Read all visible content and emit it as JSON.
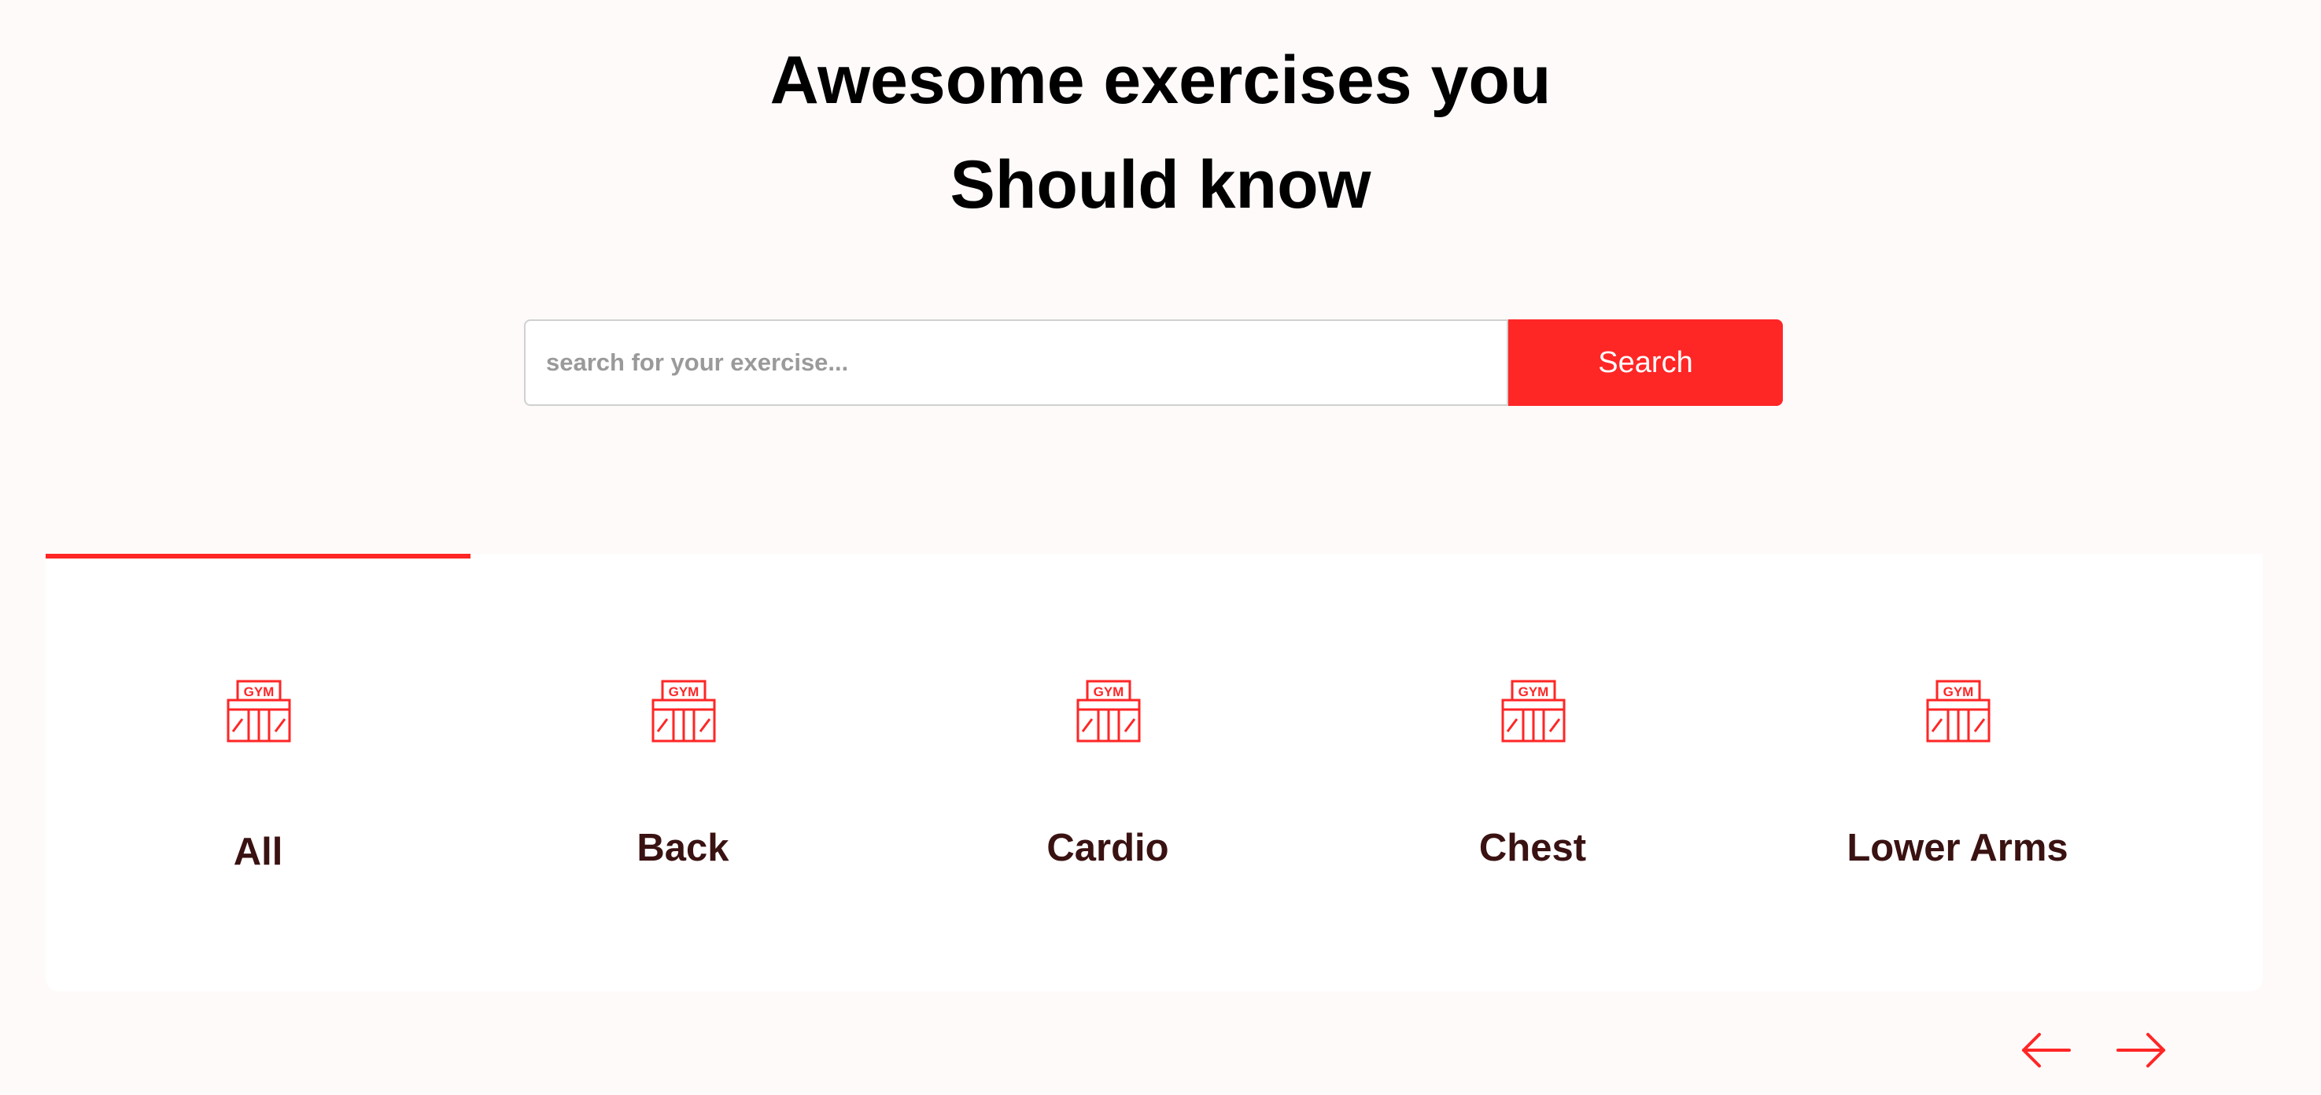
{
  "heading": {
    "line1": "Awesome exercises you",
    "line2": "Should know"
  },
  "search": {
    "placeholder": "search for your exercise...",
    "value": "",
    "button_label": "Search"
  },
  "categories": [
    {
      "label": "All",
      "icon": "gym-icon",
      "active": true
    },
    {
      "label": "Back",
      "icon": "gym-icon",
      "active": false
    },
    {
      "label": "Cardio",
      "icon": "gym-icon",
      "active": false
    },
    {
      "label": "Chest",
      "icon": "gym-icon",
      "active": false
    },
    {
      "label": "Lower Arms",
      "icon": "gym-icon",
      "active": false
    }
  ],
  "navigation": {
    "prev_icon": "arrow-left-icon",
    "next_icon": "arrow-right-icon"
  },
  "colors": {
    "accent": "#ff2626",
    "background": "#fffafa",
    "card_text": "#3a1212"
  }
}
